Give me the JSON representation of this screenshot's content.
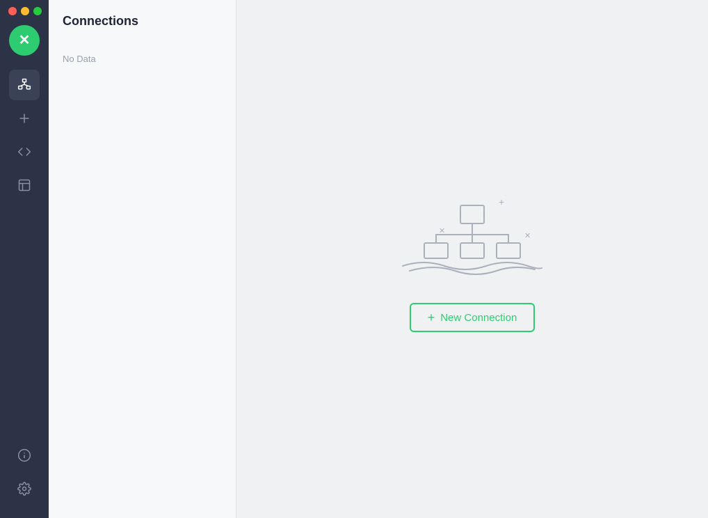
{
  "app": {
    "title": "Connections"
  },
  "sidebar": {
    "logo_icon": "✕",
    "nav_items": [
      {
        "id": "connections",
        "label": "Connections",
        "active": true
      },
      {
        "id": "add",
        "label": "Add",
        "active": false
      },
      {
        "id": "code",
        "label": "Code",
        "active": false
      },
      {
        "id": "reports",
        "label": "Reports",
        "active": false
      }
    ],
    "bottom_items": [
      {
        "id": "info",
        "label": "Info"
      },
      {
        "id": "settings",
        "label": "Settings"
      }
    ]
  },
  "left_panel": {
    "title": "Connections",
    "no_data_label": "No Data"
  },
  "content": {
    "new_connection_label": "New Connection",
    "plus_symbol": "+"
  }
}
